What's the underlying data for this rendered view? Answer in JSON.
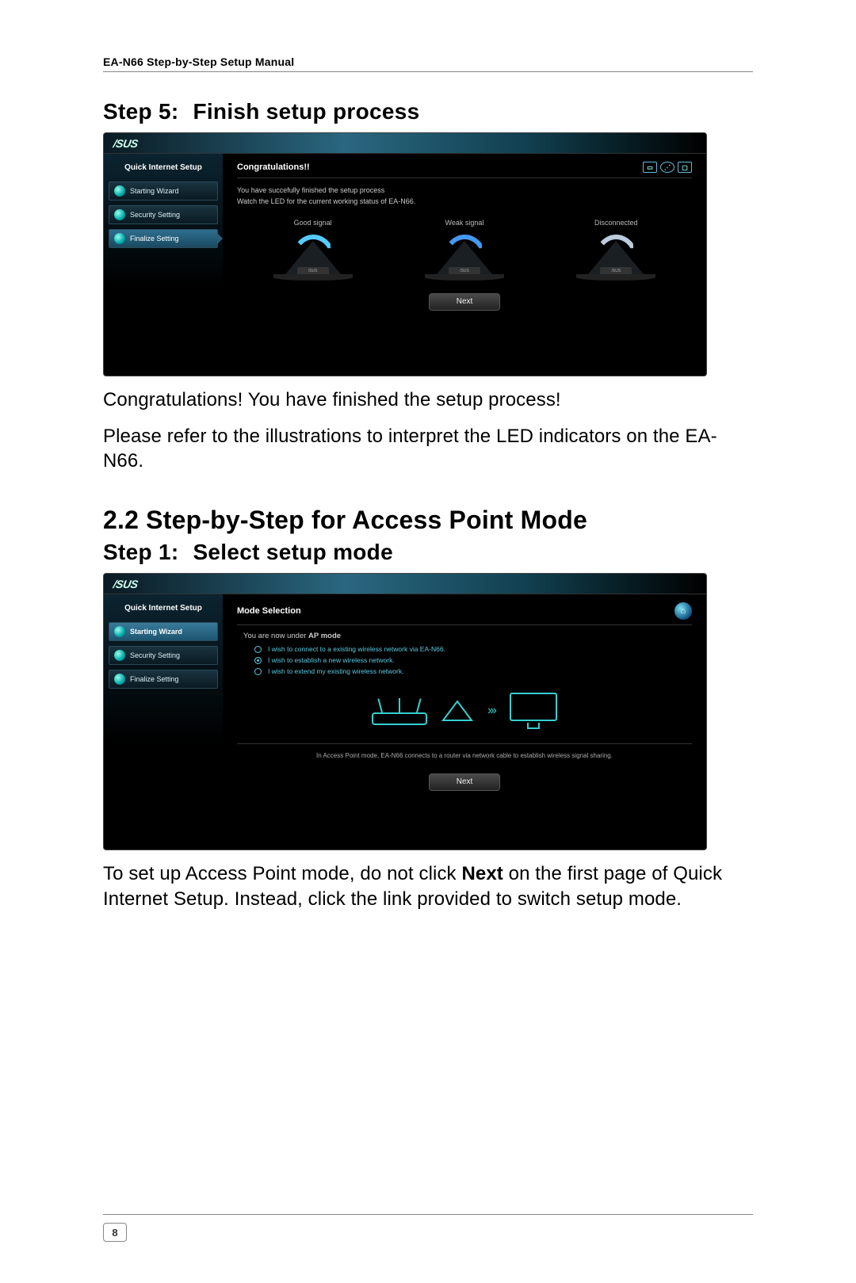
{
  "header": {
    "running": "EA-N66 Step-by-Step Setup Manual"
  },
  "step5": {
    "label": "Step 5:",
    "title": "Finish setup process"
  },
  "ui1": {
    "brand": "/SUS",
    "side_title": "Quick Internet Setup",
    "side_items": [
      "Starting Wizard",
      "Security Setting",
      "Finalize Setting"
    ],
    "panel_title": "Congratulations!!",
    "msg_line1": "You have succefully finished the setup process",
    "msg_line2": "Watch the LED for the current working status of EA-N66.",
    "col1": "Good signal",
    "col2": "Weak signal",
    "col3": "Disconnected",
    "next": "Next"
  },
  "para1": "Congratulations! You have finished the setup process!",
  "para2": "Please refer to the illustrations to interpret the LED indicators on the EA-N66.",
  "section22": "2.2 Step-by-Step for Access Point Mode",
  "step1": {
    "label": "Step 1:",
    "title": "Select setup mode"
  },
  "ui2": {
    "brand": "/SUS",
    "side_title": "Quick Internet Setup",
    "side_items": [
      "Starting Wizard",
      "Security Setting",
      "Finalize Setting"
    ],
    "panel_title": "Mode Selection",
    "mode_prefix": "You are now under ",
    "mode_bold": "AP mode",
    "opt1": "I wish to connect to a existing wireless network via EA-N66.",
    "opt2": "I wish to establish a new wireless network.",
    "opt3": "I wish to extend my existing wireless network.",
    "footer": "In Access Point mode, EA-N66 connects to a router via network cable to establish wireless signal sharing.",
    "next": "Next"
  },
  "para3_a": "To set up Access Point mode, do not click ",
  "para3_b": "Next",
  "para3_c": " on the first page of Quick Internet Setup. Instead, click the link provided to switch setup mode.",
  "page_number": "8"
}
